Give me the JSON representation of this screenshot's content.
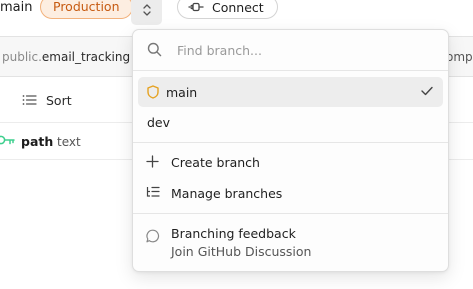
{
  "header": {
    "project_name": "main",
    "environment_badge": "Production",
    "connect_label": "Connect"
  },
  "table_tab": {
    "schema": "public.",
    "table": "email_tracking",
    "next_tab_fragment": "omp"
  },
  "toolbar": {
    "sort_label": "Sort"
  },
  "columns": [
    {
      "name": "path",
      "type": "text"
    }
  ],
  "branch_menu": {
    "search_placeholder": "Find branch...",
    "search_value": "",
    "branches": [
      {
        "label": "main",
        "selected": true,
        "protected": true
      },
      {
        "label": "dev",
        "selected": false,
        "protected": false
      }
    ],
    "actions": [
      {
        "label": "Create branch",
        "icon": "plus-icon"
      },
      {
        "label": "Manage branches",
        "icon": "list-tree-icon"
      }
    ],
    "feedback": {
      "title": "Branching feedback",
      "subtitle": "Join GitHub Discussion",
      "icon": "message-circle-icon"
    }
  },
  "colors": {
    "badge_text": "#c75b12",
    "badge_bg": "#fdeee1",
    "badge_border": "#f2b27d",
    "protected_icon": "#e5a221",
    "primary_key_icon": "#3ecf8e"
  }
}
